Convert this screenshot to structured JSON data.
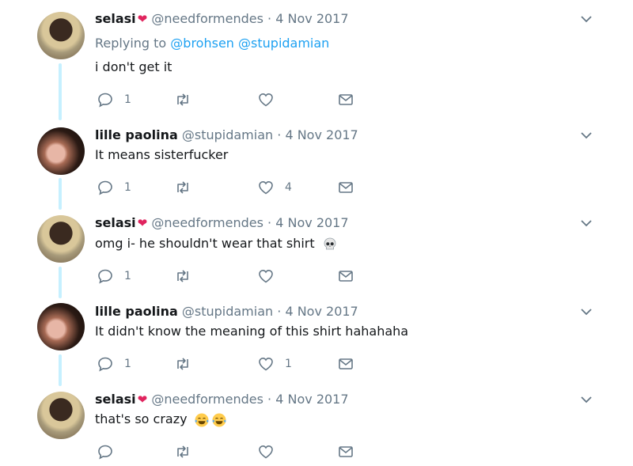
{
  "tweets": [
    {
      "name": "selasi",
      "handle": "@needformendes",
      "date": "4 Nov 2017",
      "replying_label": "Replying to",
      "replying_users": [
        "@brohsen",
        "@stupidamian"
      ],
      "text": "i don't get it",
      "counts": {
        "reply": "1",
        "like": ""
      },
      "avatar": "avatar-selasi"
    },
    {
      "name": "lille paolina",
      "handle": "@stupidamian",
      "date": "4 Nov 2017",
      "text": "It means sisterfucker",
      "counts": {
        "reply": "1",
        "like": "4"
      },
      "avatar": "avatar-lille-paolina"
    },
    {
      "name": "selasi",
      "handle": "@needformendes",
      "date": "4 Nov 2017",
      "text": "omg i- he shouldn't wear that shirt",
      "emoji": "skull-emoji",
      "counts": {
        "reply": "1",
        "like": ""
      },
      "avatar": "avatar-selasi"
    },
    {
      "name": "lille paolina",
      "handle": "@stupidamian",
      "date": "4 Nov 2017",
      "text": "It didn't know the meaning of this shirt hahahaha",
      "counts": {
        "reply": "1",
        "like": "1"
      },
      "avatar": "avatar-lille-paolina"
    },
    {
      "name": "selasi",
      "handle": "@needformendes",
      "date": "4 Nov 2017",
      "text": "that's so crazy",
      "emoji": "tears-of-joy-emoji x2",
      "counts": {
        "reply": "",
        "like": ""
      },
      "avatar": "avatar-selasi"
    }
  ],
  "separator": "·",
  "heart_glyph": "❤",
  "colors": {
    "accent": "#1da1f2",
    "thread": "#c6f0ff",
    "muted": "#657786",
    "heart": "#e0245e"
  },
  "icons": [
    "reply-icon",
    "retweet-icon",
    "like-icon",
    "message-icon",
    "chevron-down-icon"
  ]
}
